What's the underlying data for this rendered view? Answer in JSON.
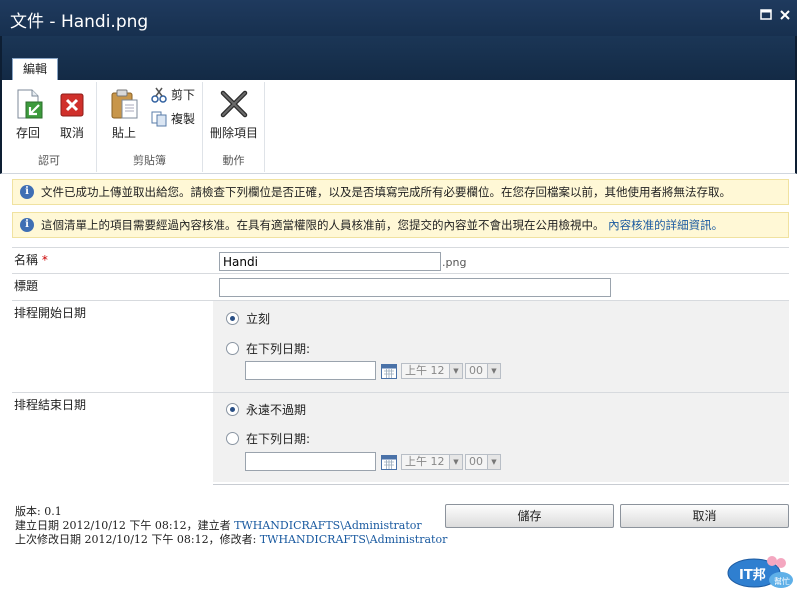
{
  "window": {
    "title": "文件 - Handi.png"
  },
  "ribbon": {
    "tab_label": "編輯",
    "groups": {
      "commit": {
        "label": "認可",
        "save_label": "存回",
        "cancel_label": "取消"
      },
      "clipboard": {
        "label": "剪貼簿",
        "paste_label": "貼上",
        "cut_label": "剪下",
        "copy_label": "複製"
      },
      "actions": {
        "label": "動作",
        "delete_label": "刪除項目"
      }
    }
  },
  "notices": {
    "checkin": "文件已成功上傳並取出給您。請檢查下列欄位是否正確，以及是否填寫完成所有必要欄位。在您存回檔案以前，其他使用者將無法存取。",
    "approval": "這個清單上的項目需要經過內容核准。在具有適當權限的人員核准前，您提交的內容並不會出現在公用檢視中。",
    "approval_link": "內容核准的詳細資訊。"
  },
  "form": {
    "name": {
      "label": "名稱",
      "required_mark": "*",
      "value": "Handi",
      "suffix": ".png"
    },
    "title": {
      "label": "標題",
      "value": ""
    },
    "start": {
      "label": "排程開始日期",
      "option_now": "立刻",
      "option_date": "在下列日期:",
      "hour": "上午 12",
      "minute": "00"
    },
    "end": {
      "label": "排程結束日期",
      "option_never": "永遠不過期",
      "option_date": "在下列日期:",
      "hour": "上午 12",
      "minute": "00"
    }
  },
  "footer": {
    "version": "版本: 0.1",
    "created_prefix": "建立日期 2012/10/12 下午 08:12，建立者",
    "created_by": "TWHANDICRAFTS\\Administrator",
    "modified_prefix": "上次修改日期 2012/10/12 下午 08:12，修改者:",
    "modified_by": "TWHANDICRAFTS\\Administrator",
    "save_label": "儲存",
    "cancel_label": "取消"
  },
  "logo": {
    "text": "IT邦",
    "sub": "幫忙"
  },
  "colors": {
    "titlebar": "#1f3a5e",
    "link": "#1a5aa0",
    "notice_bg": "#fff8d6",
    "accent_blue": "#3f6fb4"
  },
  "icons": [
    "checkin-icon",
    "cancel-icon",
    "paste-icon",
    "cut-icon",
    "copy-icon",
    "delete-icon",
    "info-icon",
    "calendar-icon",
    "maximize-icon",
    "close-icon"
  ]
}
